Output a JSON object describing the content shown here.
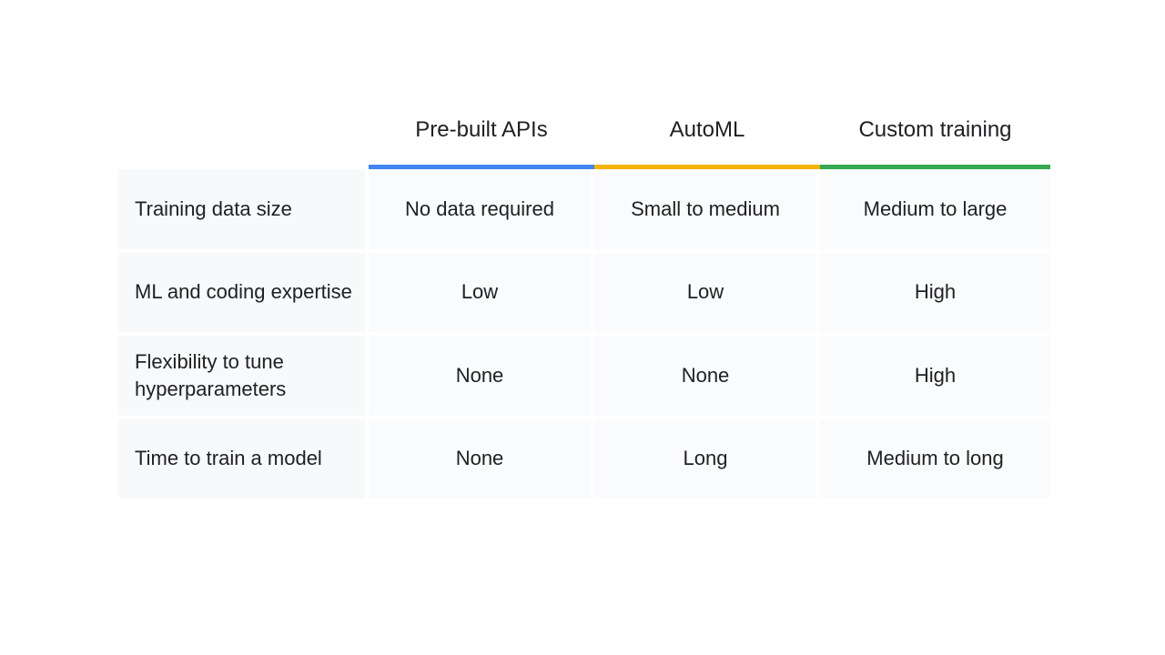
{
  "colors": {
    "blue": "#4285f4",
    "yellow": "#f4b400",
    "green": "#34a853"
  },
  "table": {
    "columns": [
      {
        "label": "Pre-built APIs",
        "accent": "#4285f4"
      },
      {
        "label": "AutoML",
        "accent": "#f4b400"
      },
      {
        "label": "Custom training",
        "accent": "#34a853"
      }
    ],
    "rows": [
      {
        "label": "Training data size",
        "values": [
          "No data required",
          "Small to medium",
          "Medium to large"
        ]
      },
      {
        "label": "ML and coding expertise",
        "values": [
          "Low",
          "Low",
          "High"
        ]
      },
      {
        "label": "Flexibility to tune hyperparameters",
        "values": [
          "None",
          "None",
          "High"
        ]
      },
      {
        "label": "Time to train a model",
        "values": [
          "None",
          "Long",
          "Medium to long"
        ]
      }
    ]
  }
}
